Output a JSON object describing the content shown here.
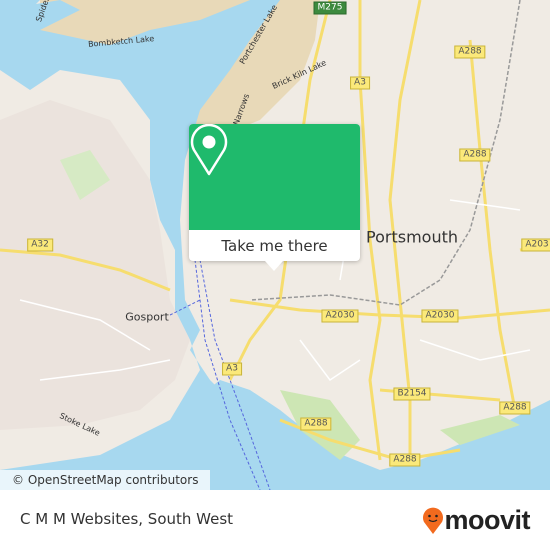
{
  "map": {
    "places": {
      "portsmouth": "Portsmouth",
      "gosport": "Gosport"
    },
    "water_labels": {
      "bombketch": "Bombketch Lake",
      "portchester": "Portchester Lake",
      "brick_kiln": "Brick Kiln Lake",
      "narrows": "Narrows",
      "stoke": "Stoke Lake",
      "spider": "Spider"
    },
    "roads": [
      "M275",
      "A3",
      "A288",
      "A288",
      "A203",
      "A32",
      "A2030",
      "A2030",
      "A3",
      "B2154",
      "A288",
      "A288",
      "A288"
    ],
    "attribution": "© OpenStreetMap contributors",
    "colors": {
      "water": "#a7d8ef",
      "land": "#f0ebe4",
      "park": "#cde6b4",
      "popup": "#1fba6c",
      "brand": "#f26a1e"
    }
  },
  "popup": {
    "cta": "Take me there",
    "icon": "map-pin-icon"
  },
  "footer": {
    "title": "C M M Websites, South West",
    "logo": "moovit"
  }
}
